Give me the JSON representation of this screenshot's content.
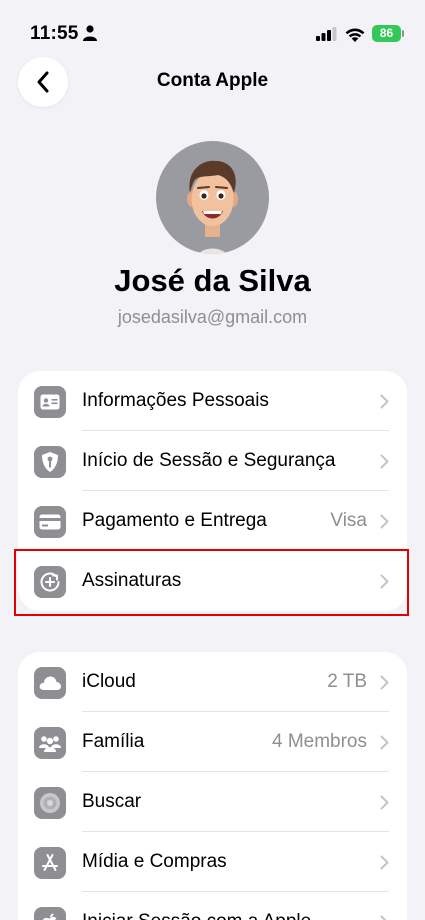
{
  "status_bar": {
    "time": "11:55",
    "battery": "86"
  },
  "nav": {
    "title": "Conta Apple"
  },
  "profile": {
    "name": "José da Silva",
    "email": "josedasilva@gmail.com"
  },
  "group1": [
    {
      "label": "Informações Pessoais",
      "value": "",
      "icon": "person-card-icon"
    },
    {
      "label": "Início de Sessão e Segurança",
      "value": "",
      "icon": "key-shield-icon"
    },
    {
      "label": "Pagamento e Entrega",
      "value": "Visa",
      "icon": "credit-card-icon"
    },
    {
      "label": "Assinaturas",
      "value": "",
      "icon": "subscriptions-icon"
    }
  ],
  "group2": [
    {
      "label": "iCloud",
      "value": "2 TB",
      "icon": "cloud-icon"
    },
    {
      "label": "Família",
      "value": "4 Membros",
      "icon": "family-icon"
    },
    {
      "label": "Buscar",
      "value": "",
      "icon": "find-my-icon"
    },
    {
      "label": "Mídia e Compras",
      "value": "",
      "icon": "app-store-icon"
    },
    {
      "label": "Iniciar Sessão com a Apple",
      "value": "",
      "icon": "apple-logo-icon"
    }
  ]
}
